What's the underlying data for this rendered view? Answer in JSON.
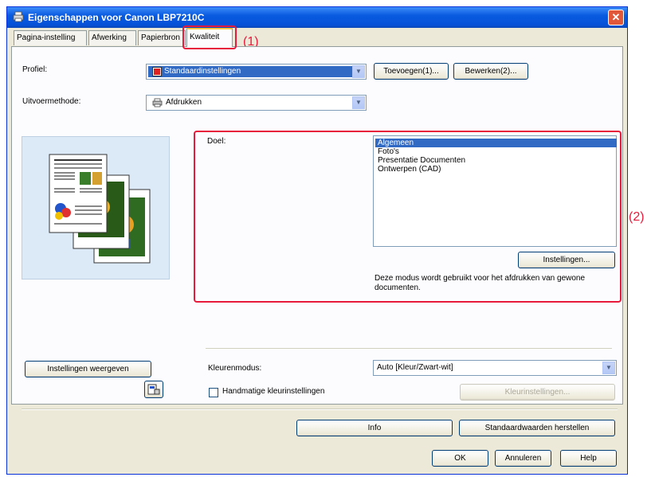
{
  "window": {
    "title": "Eigenschappen voor Canon LBP7210C",
    "close_label": "✕"
  },
  "tabs": [
    {
      "label": "Pagina-instelling"
    },
    {
      "label": "Afwerking"
    },
    {
      "label": "Papierbron"
    },
    {
      "label": "Kwaliteit"
    }
  ],
  "callouts": {
    "one": "(1)",
    "two": "(2)"
  },
  "profile": {
    "label": "Profiel:",
    "value": "Standaardinstellingen",
    "add_button": "Toevoegen(1)...",
    "edit_button": "Bewerken(2)..."
  },
  "output": {
    "label": "Uitvoermethode:",
    "value": "Afdrukken"
  },
  "doel": {
    "label": "Doel:",
    "items": [
      "Algemeen",
      "Foto's",
      "Presentatie Documenten",
      "Ontwerpen (CAD)"
    ],
    "selected": "Algemeen",
    "settings_button": "Instellingen...",
    "description": "Deze modus wordt gebruikt voor het afdrukken van gewone documenten."
  },
  "view_settings_button": "Instellingen weergeven",
  "color": {
    "label": "Kleurenmodus:",
    "value": "Auto [Kleur/Zwart-wit]",
    "manual_label": "Handmatige kleurinstellingen",
    "manual_checked": false,
    "color_settings_button": "Kleurinstellingen..."
  },
  "footer": {
    "info_button": "Info",
    "restore_button": "Standaardwaarden herstellen",
    "ok_button": "OK",
    "cancel_button": "Annuleren",
    "help_button": "Help"
  },
  "colors": {
    "highlight": "#e81a3c",
    "titlebar": "#0a5be0",
    "selection": "#316ac5"
  }
}
